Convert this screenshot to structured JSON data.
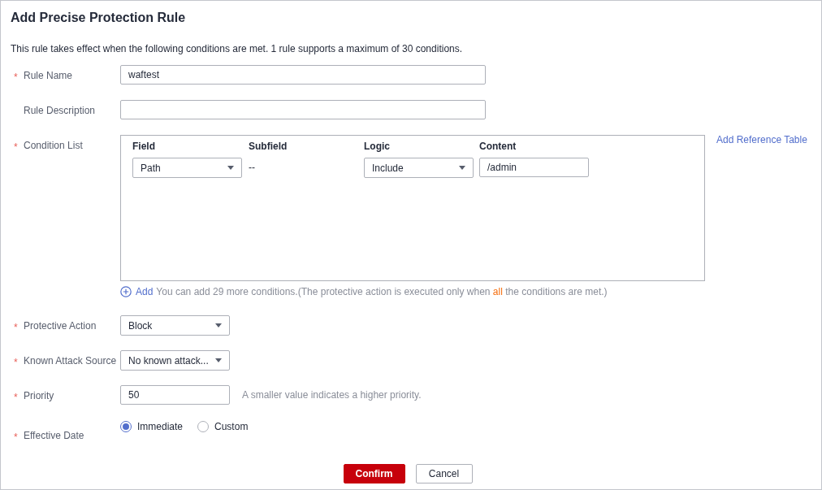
{
  "title": "Add Precise Protection Rule",
  "intro": "This rule takes effect when the following conditions are met. 1 rule supports a maximum of 30 conditions.",
  "required_mark": "*",
  "fields": [
    {
      "kind": "text",
      "label": "Rule Name",
      "required": true,
      "value": "waftest"
    },
    {
      "kind": "text",
      "label": "Rule Description",
      "required": false
    },
    {
      "kind": "conditions",
      "label": "Condition List",
      "required": true,
      "columns": [
        "Field",
        "Subfield",
        "Logic",
        "Content"
      ],
      "rows": [
        {
          "field": "Path",
          "subfield": "--",
          "logic": "Include",
          "content": "/admin"
        }
      ],
      "link": "Add Reference Table",
      "add_label": "Add",
      "hint_before": "You can add 29 more conditions.(The protective action is executed only when ",
      "hint_highlight": "all",
      "hint_after": " the conditions are met.)"
    },
    {
      "kind": "select",
      "label": "Protective Action",
      "required": true,
      "value": "Block"
    },
    {
      "kind": "select",
      "label": "Known Attack Source",
      "required": true,
      "value": "No known attack..."
    },
    {
      "kind": "text",
      "label": "Priority",
      "required": true,
      "value": "50",
      "hint": "A smaller value indicates a higher priority."
    },
    {
      "kind": "radio",
      "label": "Effective Date",
      "required": true,
      "options": [
        {
          "label": "Immediate",
          "selected": true
        },
        {
          "label": "Custom",
          "selected": false
        }
      ]
    }
  ],
  "buttons": [
    {
      "label": "Confirm",
      "kind": "primary"
    },
    {
      "label": "Cancel",
      "kind": "default"
    }
  ]
}
